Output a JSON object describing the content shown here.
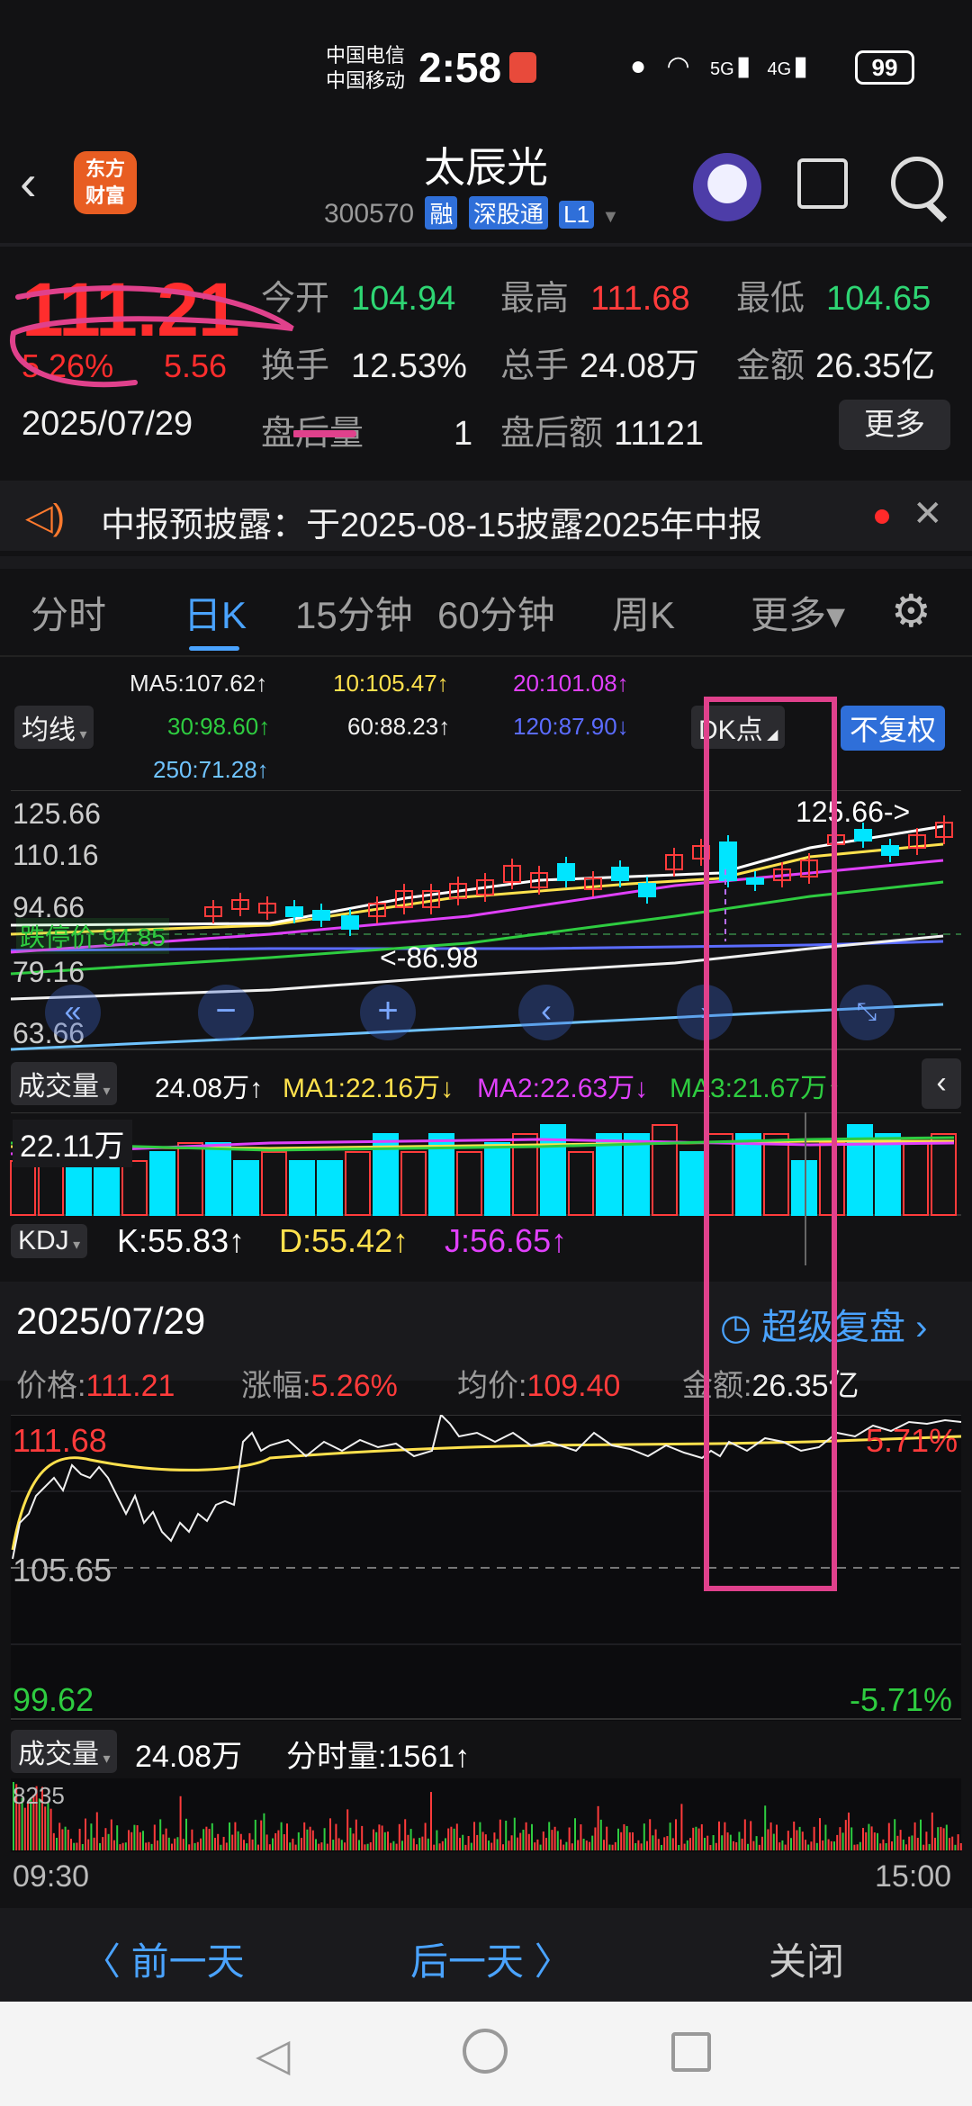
{
  "status_bar": {
    "carrier1": "中国电信",
    "carrier2": "中国移动",
    "time": "2:58",
    "signal1": "5G",
    "signal2": "4G",
    "battery": "99"
  },
  "header": {
    "back_icon": "chevron-left-icon",
    "logo_line1": "东方",
    "logo_line2": "财富",
    "title": "太辰光",
    "code": "300570",
    "tag1": "融",
    "tag2": "深股通",
    "tag3": "L1"
  },
  "quote": {
    "price": "111.21",
    "change_pct": "5.26%",
    "change_amt": "5.56",
    "date": "2025/07/29",
    "open_label": "今开",
    "open_value": "104.94",
    "high_label": "最高",
    "high_value": "111.68",
    "low_label": "最低",
    "low_value": "104.65",
    "turnover_label": "换手",
    "turnover_value": "12.53%",
    "volume_label": "总手",
    "volume_value": "24.08万",
    "amount_label": "金额",
    "amount_value": "26.35亿",
    "after_vol_label": "盘后量",
    "after_vol_value": "1",
    "after_amt_label": "盘后额",
    "after_amt_value": "11121",
    "more_button": "更多"
  },
  "notice": {
    "text": "中报预披露：于2025-08-15披露2025年中报"
  },
  "tabs": [
    {
      "label": "分时"
    },
    {
      "label": "日K"
    },
    {
      "label": "15分钟"
    },
    {
      "label": "60分钟"
    },
    {
      "label": "周K"
    },
    {
      "label": "更多▾"
    }
  ],
  "kline": {
    "ma_select": "均线",
    "ma5": "MA5:107.62↑",
    "ma10": "10:105.47↑",
    "ma20": "20:101.08↑",
    "ma30": "30:98.60↑",
    "ma60": "60:88.23↑",
    "ma120": "120:87.90↓",
    "ma250": "250:71.28↑",
    "dk_button": "DK点",
    "fq_button": "不复权",
    "y_labels": [
      "125.66",
      "110.16",
      "94.66",
      "79.16",
      "63.66"
    ],
    "max_label": "125.66->",
    "min_label": "<-86.98",
    "limit_label": "跌停价 94.85",
    "colors": {
      "up": "#ff3b3b",
      "down": "#00e5ff",
      "ma5": "#ffffff",
      "ma10": "#ffe14d",
      "ma20": "#e040fb",
      "ma30": "#2ecc40",
      "ma60": "#f0f0f0",
      "ma120": "#5b6cff",
      "ma250": "#6fc3ff"
    }
  },
  "volume": {
    "select": "成交量",
    "total": "24.08万↑",
    "ma1": "MA1:22.16万↓",
    "ma2": "MA2:22.63万↓",
    "ma3": "MA3:21.67万↑",
    "y_label": "22.11万"
  },
  "kdj": {
    "select": "KDJ",
    "k": "K:55.83↑",
    "d": "D:55.42↑",
    "j": "J:56.65↑"
  },
  "intraday": {
    "date": "2025/07/29",
    "replay_button": "超级复盘",
    "price_label": "价格:",
    "price_value": "111.21",
    "change_label": "涨幅:",
    "change_value": "5.26%",
    "avg_label": "均价:",
    "avg_value": "109.40",
    "amount_label": "金额:",
    "amount_value": "26.35亿",
    "high": "111.68",
    "mid": "105.65",
    "low": "99.62",
    "pct_high": "5.71%",
    "pct_low": "-5.71%",
    "vol_select": "成交量",
    "vol_total": "24.08万",
    "vol_tick": "分时量:1561↑",
    "vol_max": "8235",
    "time_start": "09:30",
    "time_end": "15:00"
  },
  "bottom_nav": {
    "prev": "〈 前一天",
    "next": "后一天 〉",
    "close": "关闭"
  }
}
